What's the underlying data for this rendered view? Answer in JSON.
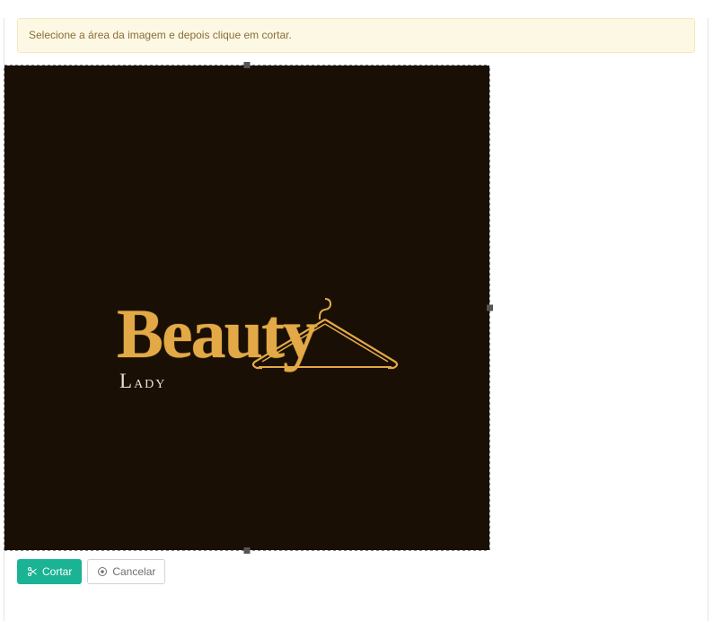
{
  "alert": {
    "text": "Selecione a área da imagem e depois clique em cortar."
  },
  "logo": {
    "primary": "Beauty",
    "secondary": "Lady"
  },
  "buttons": {
    "crop": "Cortar",
    "cancel": "Cancelar"
  },
  "icons": {
    "scissors": "scissors-icon",
    "cancel": "cancel-circle-icon",
    "hanger": "hanger-icon"
  },
  "colors": {
    "accent": "#1ab394",
    "gold": "#e3a946",
    "alert_bg": "#fcf8e3"
  }
}
